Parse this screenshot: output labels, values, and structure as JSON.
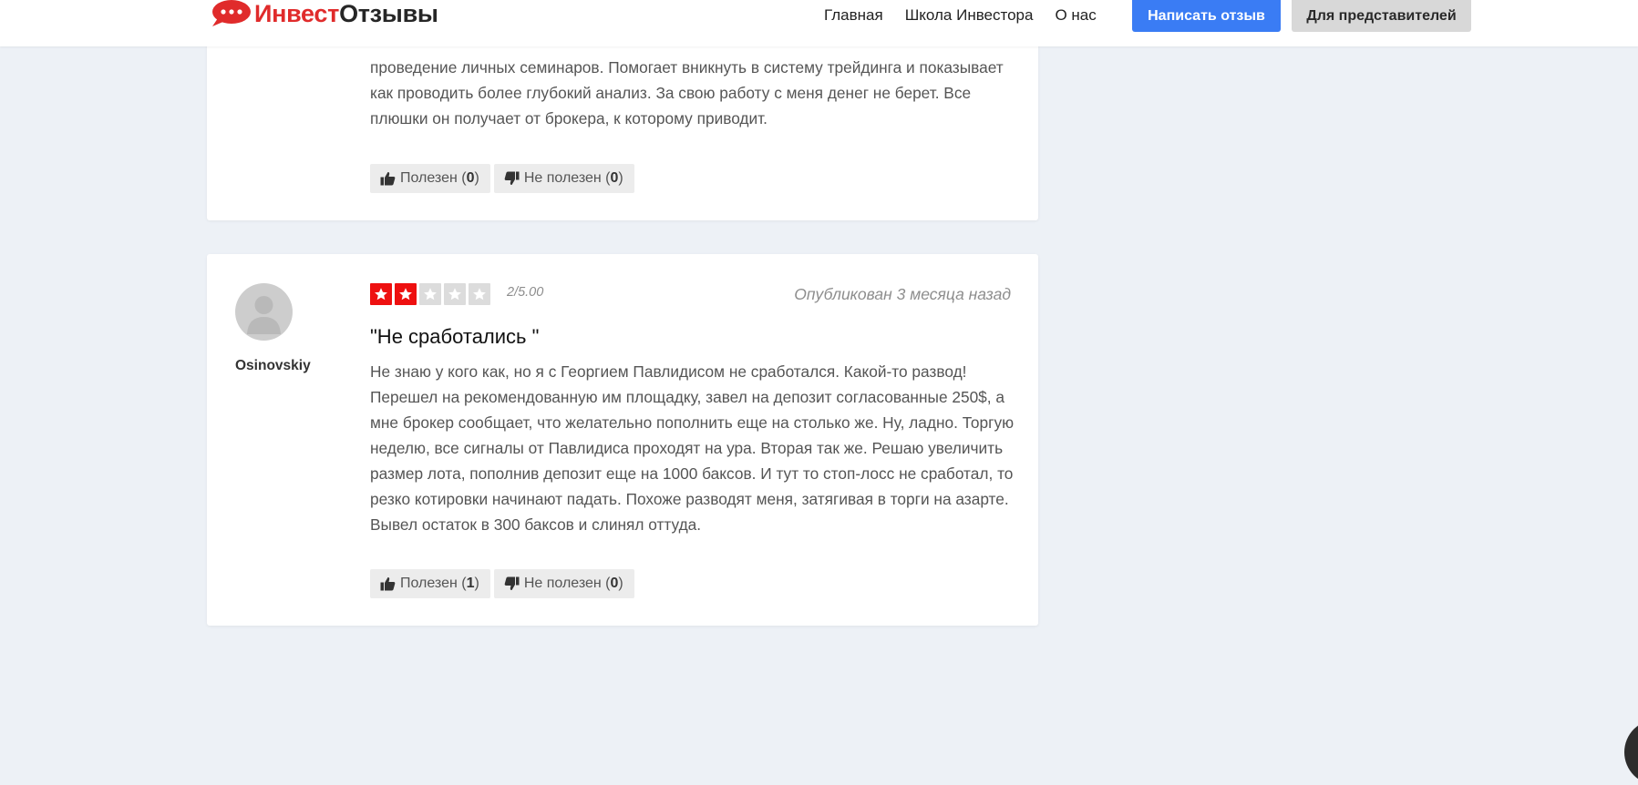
{
  "header": {
    "logo": {
      "part1": "Инвест",
      "part2": "Отзывы",
      "colors": {
        "part1": "#e02b2b",
        "part2": "#262626",
        "icon": "#e02b2b"
      }
    },
    "nav": [
      "Главная",
      "Школа Инвестора",
      "О нас"
    ],
    "write_review_button": "Написать отзыв",
    "representatives_button": "Для представителей",
    "colors": {
      "primary_button": "#3a7cf4",
      "secondary_button": "#d8d8d8"
    }
  },
  "reviews": [
    {
      "text": "проведение личных семинаров. Помогает вникнуть в систему трейдинга и показывает как проводить более глубокий анализ. За свою работу с меня денег не берет. Все плюшки он получает от брокера, к которому приводит.",
      "helpful_label": "Полезен",
      "helpful_count": "0",
      "not_helpful_label": "Не полезен",
      "not_helpful_count": "0"
    },
    {
      "author": "Osinovskiy",
      "rating": 2,
      "rating_max": 5,
      "score": "2/5.00",
      "published": "Опубликован 3 месяца назад",
      "title": "\"Не сработались \"",
      "text": "Не знаю у кого как, но я с Георгием Павлидисом не сработался. Какой-то развод! Перешел на рекомендованную им площадку, завел на депозит согласованные 250$, а мне брокер сообщает, что желательно пополнить еще на столько же. Ну, ладно. Торгую неделю, все сигналы от Павлидиса проходят на ура. Вторая так же. Решаю увеличить размер лота, пополнив депозит еще на 1000 баксов. И тут то стоп-лосс не сработал, то резко котировки начинают падать. Похоже разводят меня, затягивая в торги на азарте. Вывел остаток в 300 баксов и слинял оттуда.",
      "helpful_label": "Полезен",
      "helpful_count": "1",
      "not_helpful_label": "Не полезен",
      "not_helpful_count": "0"
    }
  ],
  "colors": {
    "page_background": "#edf1f6",
    "star_active": "#ee1010",
    "star_inactive": "#dcdcdc"
  },
  "icons": [
    "logo-speech-bubble-icon",
    "thumbs-up-icon",
    "thumbs-down-icon",
    "star-icon",
    "avatar-placeholder-icon"
  ]
}
